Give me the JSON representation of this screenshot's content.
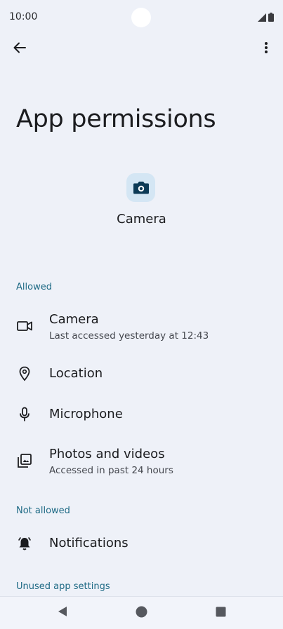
{
  "status_bar": {
    "time": "10:00"
  },
  "app_bar": {
    "back_icon": "arrow-left-icon",
    "more_icon": "more-vertical-icon"
  },
  "page": {
    "title": "App permissions",
    "app_icon": "camera-app-icon",
    "app_name": "Camera"
  },
  "sections": {
    "allowed_header": "Allowed",
    "not_allowed_header": "Not allowed",
    "unused_header": "Unused app settings"
  },
  "permissions": {
    "camera": {
      "title": "Camera",
      "subtitle": "Last accessed yesterday at 12:43",
      "icon": "videocam-icon"
    },
    "location": {
      "title": "Location",
      "icon": "location-pin-icon"
    },
    "microphone": {
      "title": "Microphone",
      "icon": "microphone-icon"
    },
    "photos": {
      "title": "Photos and videos",
      "subtitle": "Accessed in past 24 hours",
      "icon": "photo-library-icon"
    },
    "notifications": {
      "title": "Notifications",
      "icon": "notifications-off-icon"
    }
  },
  "nav_bar": {
    "back_icon": "nav-back-icon",
    "home_icon": "nav-home-icon",
    "recents_icon": "nav-recents-icon"
  },
  "colors": {
    "background": "#eef1f8",
    "accent": "#1e6a85",
    "app_icon_bg": "#d4e6f4"
  }
}
